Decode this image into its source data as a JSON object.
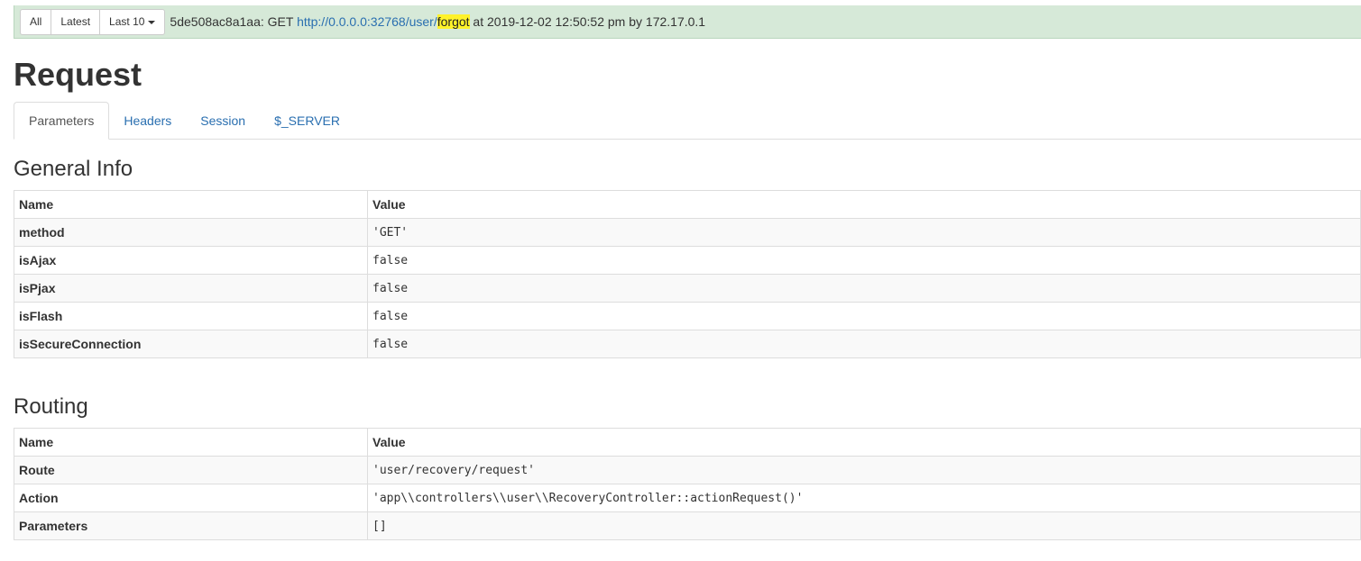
{
  "toolbar": {
    "all_label": "All",
    "latest_label": "Latest",
    "last10_label": "Last 10"
  },
  "summary": {
    "tag": "5de508ac8a1aa",
    "method_text": ": GET ",
    "url_prefix": "http://0.0.0.0:32768/user/",
    "url_highlight": "forgot",
    "suffix": " at 2019-12-02 12:50:52 pm by 172.17.0.1"
  },
  "page_title": "Request",
  "tabs": [
    "Parameters",
    "Headers",
    "Session",
    "$_SERVER"
  ],
  "general_info": {
    "title": "General Info",
    "headers": [
      "Name",
      "Value"
    ],
    "rows": [
      {
        "name": "method",
        "value": "'GET'"
      },
      {
        "name": "isAjax",
        "value": "false"
      },
      {
        "name": "isPjax",
        "value": "false"
      },
      {
        "name": "isFlash",
        "value": "false"
      },
      {
        "name": "isSecureConnection",
        "value": "false"
      }
    ]
  },
  "routing": {
    "title": "Routing",
    "headers": [
      "Name",
      "Value"
    ],
    "rows": [
      {
        "name": "Route",
        "value": "'user/recovery/request'"
      },
      {
        "name": "Action",
        "value": "'app\\\\controllers\\\\user\\\\RecoveryController::actionRequest()'"
      },
      {
        "name": "Parameters",
        "value": "[]"
      }
    ]
  }
}
